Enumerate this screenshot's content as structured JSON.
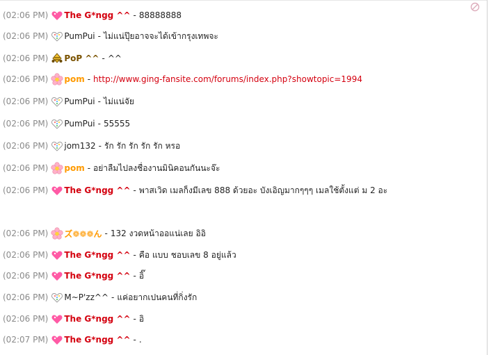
{
  "messages": [
    {
      "time": "(02:06 PM)",
      "icon": "pink-heart-icon",
      "name": "The G*ngg ^^",
      "name_style": "red",
      "sep": "-",
      "text": "88888888",
      "text_style": "normal"
    },
    {
      "time": "(02:06 PM)",
      "icon": "rainbow-heart-icon",
      "name": "PumPui",
      "name_style": "black",
      "sep": "-",
      "text": "ไม่แน่ปุ๊ยอาจจะได้เข้ากรุงเทพจะ",
      "text_style": "normal"
    },
    {
      "time": "(02:06 PM)",
      "icon": "bee-icon",
      "name": "PoP ^^",
      "name_style": "olive",
      "sep": "-",
      "text": "^^",
      "text_style": "normal"
    },
    {
      "time": "(02:06 PM)",
      "icon": "pink-flower-icon",
      "name": "pom",
      "name_style": "orange",
      "sep": "-",
      "text": "http://www.ging-fansite.com/forums/index.php?showtopic=1994",
      "text_style": "link"
    },
    {
      "time": "(02:06 PM)",
      "icon": "rainbow-heart-icon",
      "name": "PumPui",
      "name_style": "black",
      "sep": "-",
      "text": "ไม่แน่จัย",
      "text_style": "normal"
    },
    {
      "time": "(02:06 PM)",
      "icon": "rainbow-heart-icon",
      "name": "PumPui",
      "name_style": "black",
      "sep": "-",
      "text": "55555",
      "text_style": "normal"
    },
    {
      "time": "(02:06 PM)",
      "icon": "rainbow-heart-icon",
      "name": "jom132",
      "name_style": "black",
      "sep": "-",
      "text": "รัก รัก รัก รัก รัก หรอ",
      "text_style": "normal"
    },
    {
      "time": "(02:06 PM)",
      "icon": "pink-flower-icon",
      "name": "pom",
      "name_style": "orange",
      "sep": "-",
      "text": "อย่าลืมไปลงชื่องานมินิคอนกันนะจ๊ะ",
      "text_style": "normal"
    },
    {
      "time": "(02:06 PM)",
      "icon": "pink-heart-icon",
      "name": "The G*ngg ^^",
      "name_style": "red",
      "sep": "-",
      "text": "พาสเวิด เมลก็งมีเลข 888 ด้วยอะ บังเอิญมากๆๆๆ เมลใช้ตั้งแต่ ม 2 อะ",
      "text_style": "normal"
    },
    {
      "time": "(02:06 PM)",
      "icon": "pink-flower-icon",
      "name": "ズ❁❁❁ん",
      "name_style": "orange",
      "sep": "-",
      "text": "132 งวดหน้าออแน่เลย อิอิ",
      "text_style": "normal"
    },
    {
      "time": "(02:06 PM)",
      "icon": "pink-heart-icon",
      "name": "The G*ngg ^^",
      "name_style": "red",
      "sep": "-",
      "text": "คือ แบบ ชอบเลข 8 อยู่แล้ว",
      "text_style": "normal"
    },
    {
      "time": "(02:06 PM)",
      "icon": "pink-heart-icon",
      "name": "The G*ngg ^^",
      "name_style": "red",
      "sep": "-",
      "text": "อิ๊",
      "text_style": "normal"
    },
    {
      "time": "(02:06 PM)",
      "icon": "rainbow-heart-icon",
      "name": "M~P'zz^^",
      "name_style": "black",
      "sep": "-",
      "text": "แค่อยากเปนคนที่กิ่งรัก",
      "text_style": "normal"
    },
    {
      "time": "(02:06 PM)",
      "icon": "pink-heart-icon",
      "name": "The G*ngg ^^",
      "name_style": "red",
      "sep": "-",
      "text": "อิ",
      "text_style": "normal"
    },
    {
      "time": "(02:07 PM)",
      "icon": "pink-heart-icon",
      "name": "The G*ngg ^^",
      "name_style": "red",
      "sep": "-",
      "text": ".",
      "text_style": "normal"
    }
  ]
}
